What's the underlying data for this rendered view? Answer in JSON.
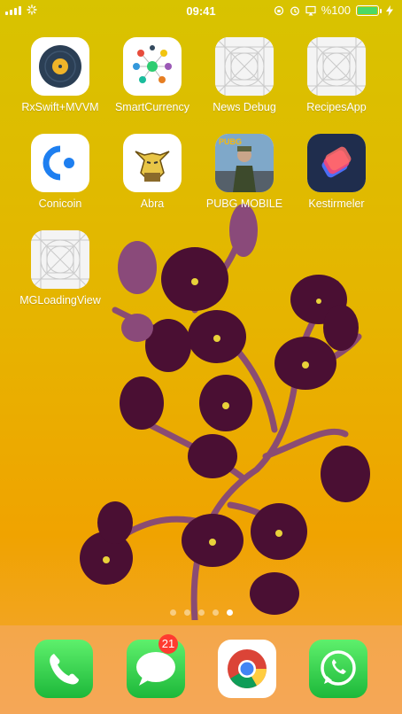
{
  "status_bar": {
    "time": "09:41",
    "battery_text": "%100"
  },
  "apps": [
    {
      "label": "RxSwift+MVVM",
      "icon": "vinyl-record-icon"
    },
    {
      "label": "SmartCurrency",
      "icon": "currency-network-icon"
    },
    {
      "label": "News Debug",
      "icon": "placeholder-grid-icon"
    },
    {
      "label": "RecipesApp",
      "icon": "placeholder-grid-icon"
    },
    {
      "label": "Conicoin",
      "icon": "conicoin-logo-icon"
    },
    {
      "label": "Abra",
      "icon": "abra-pokemon-icon"
    },
    {
      "label": "PUBG MOBILE",
      "icon": "pubg-soldier-icon"
    },
    {
      "label": "Kestirmeler",
      "icon": "shortcuts-icon"
    },
    {
      "label": "MGLoadingView",
      "icon": "placeholder-grid-icon"
    }
  ],
  "page_dots": {
    "count": 5,
    "active_index": 4
  },
  "dock": [
    {
      "label": "Phone",
      "icon": "phone-icon"
    },
    {
      "label": "Messages",
      "icon": "messages-icon",
      "badge": "21"
    },
    {
      "label": "Chrome",
      "icon": "chrome-icon"
    },
    {
      "label": "WhatsApp",
      "icon": "whatsapp-icon"
    }
  ],
  "colors": {
    "wallpaper_top": "#d8c300",
    "wallpaper_bottom": "#f4a53e",
    "badge": "#ff3b30",
    "battery_fill": "#4cd964"
  }
}
